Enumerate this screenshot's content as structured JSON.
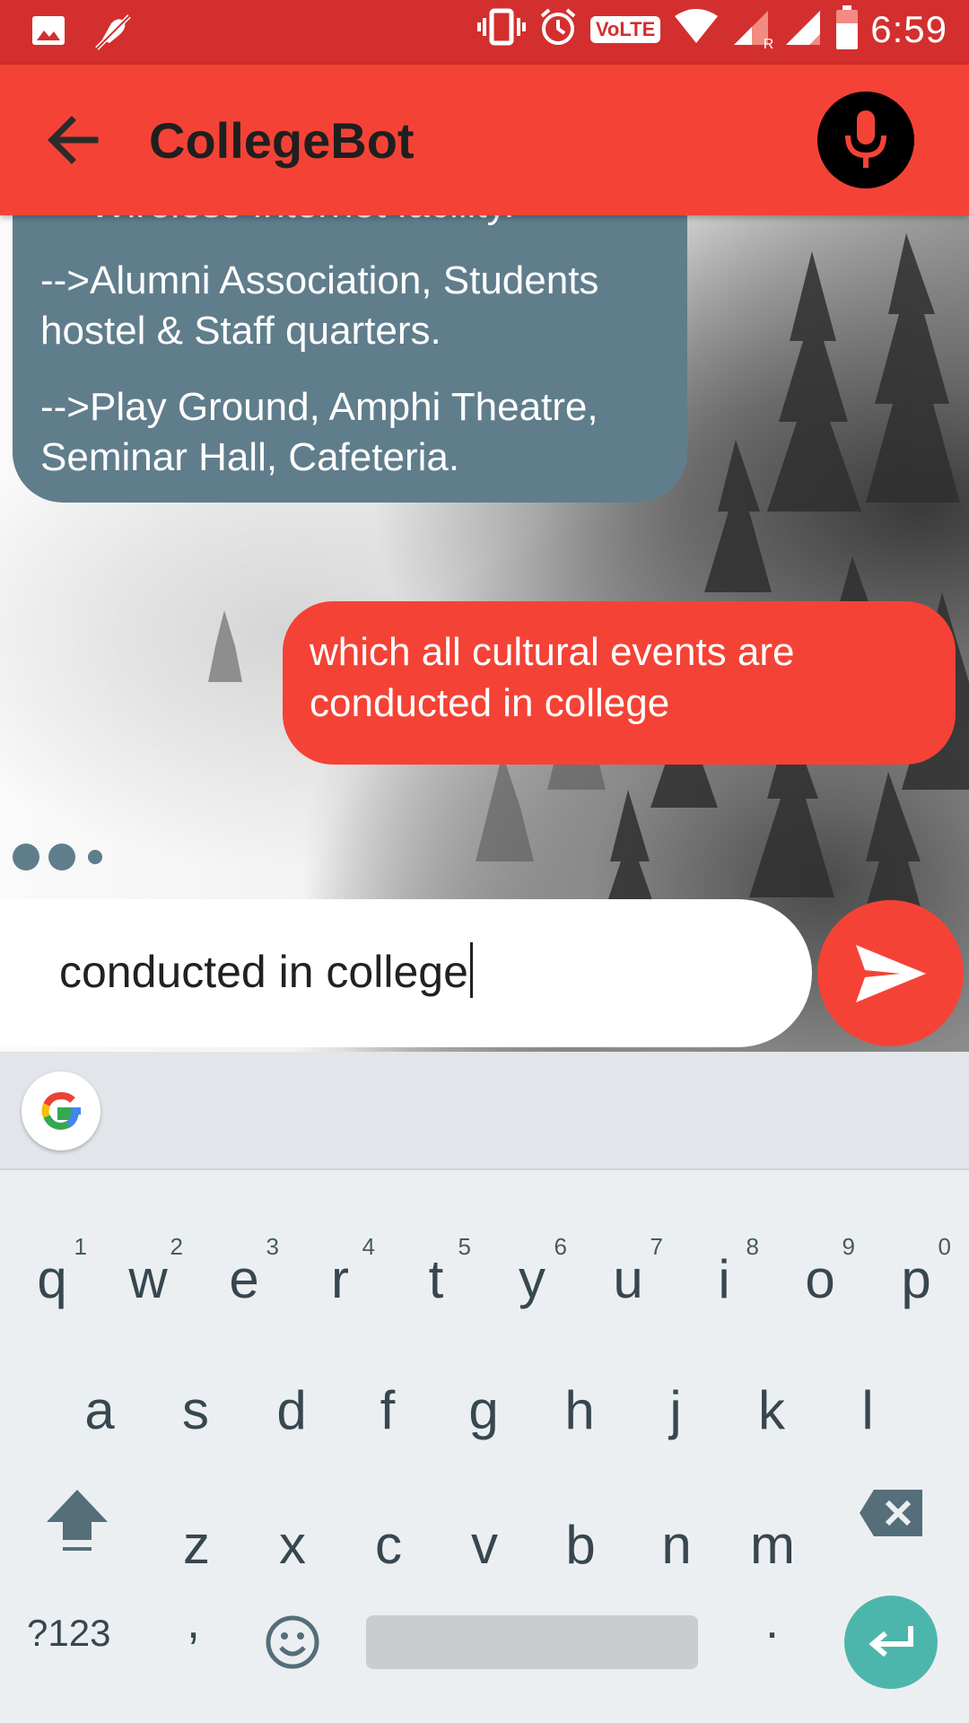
{
  "status_bar": {
    "time": "6:59",
    "volte": "VoLTE",
    "icons": [
      "image-icon",
      "mute-icon",
      "vibrate-icon",
      "alarm-icon",
      "wifi-icon",
      "signal-icon",
      "battery-icon"
    ],
    "roaming_label": "R",
    "background": "#d32f2f"
  },
  "app_bar": {
    "title": "CollegeBot",
    "back_icon": "arrow-left-icon",
    "mic_icon": "mic-icon",
    "background": "#f44336"
  },
  "chat": {
    "bot_message_lines": [
      "-->Wireless Internet facility.",
      "-->Alumni Association, Students",
      "hostel & Staff quarters.",
      "-->Play Ground, Amphi Theatre,",
      "Seminar Hall, Cafeteria."
    ],
    "user_message": "which all cultural events are conducted in college",
    "bot_bubble_color": "#607d8b",
    "user_bubble_color": "#f44336"
  },
  "input": {
    "value": "conducted in college",
    "send_icon": "send-icon"
  },
  "keyboard": {
    "row1": [
      {
        "key": "q",
        "hint": "1"
      },
      {
        "key": "w",
        "hint": "2"
      },
      {
        "key": "e",
        "hint": "3"
      },
      {
        "key": "r",
        "hint": "4"
      },
      {
        "key": "t",
        "hint": "5"
      },
      {
        "key": "y",
        "hint": "6"
      },
      {
        "key": "u",
        "hint": "7"
      },
      {
        "key": "i",
        "hint": "8"
      },
      {
        "key": "o",
        "hint": "9"
      },
      {
        "key": "p",
        "hint": "0"
      }
    ],
    "row2": [
      "a",
      "s",
      "d",
      "f",
      "g",
      "h",
      "j",
      "k",
      "l"
    ],
    "row3": [
      "z",
      "x",
      "c",
      "v",
      "b",
      "n",
      "m"
    ],
    "symbols_label": "?123",
    "comma": ",",
    "period": ".",
    "enter_color": "#4db6ac"
  }
}
